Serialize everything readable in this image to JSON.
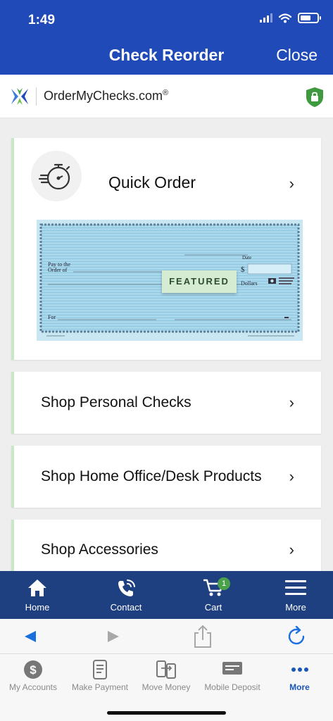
{
  "status_bar": {
    "time": "1:49"
  },
  "nav": {
    "title": "Check Reorder",
    "close": "Close"
  },
  "brand": {
    "name": "OrderMyChecks.com",
    "reg": "®"
  },
  "quick_order": {
    "label": "Quick Order",
    "badge": "FEATURED"
  },
  "check_sample": {
    "pay_to": "Pay to the",
    "order_of": "Order of",
    "date": "Date",
    "dollar_sign": "$",
    "dollars": "Dollars",
    "for": "For"
  },
  "menu": [
    {
      "label": "Shop Personal Checks"
    },
    {
      "label": "Shop Home Office/Desk Products"
    },
    {
      "label": "Shop Accessories"
    }
  ],
  "tabs": [
    {
      "label": "Home",
      "icon": "home-icon"
    },
    {
      "label": "Contact",
      "icon": "phone-icon"
    },
    {
      "label": "Cart",
      "icon": "cart-icon",
      "badge": "1"
    },
    {
      "label": "More",
      "icon": "hamburger-icon"
    }
  ],
  "bottom_nav": [
    {
      "label": "My Accounts",
      "icon": "dollar-circle-icon"
    },
    {
      "label": "Make Payment",
      "icon": "bill-phone-icon"
    },
    {
      "label": "Move Money",
      "icon": "transfer-icon"
    },
    {
      "label": "Mobile Deposit",
      "icon": "check-deposit-icon"
    },
    {
      "label": "More",
      "icon": "ellipsis-icon"
    }
  ],
  "colors": {
    "primary": "#1f4ab8",
    "tab_bar": "#1f4080",
    "accent_green": "#4ba14b",
    "active_blue": "#1a56b8"
  }
}
